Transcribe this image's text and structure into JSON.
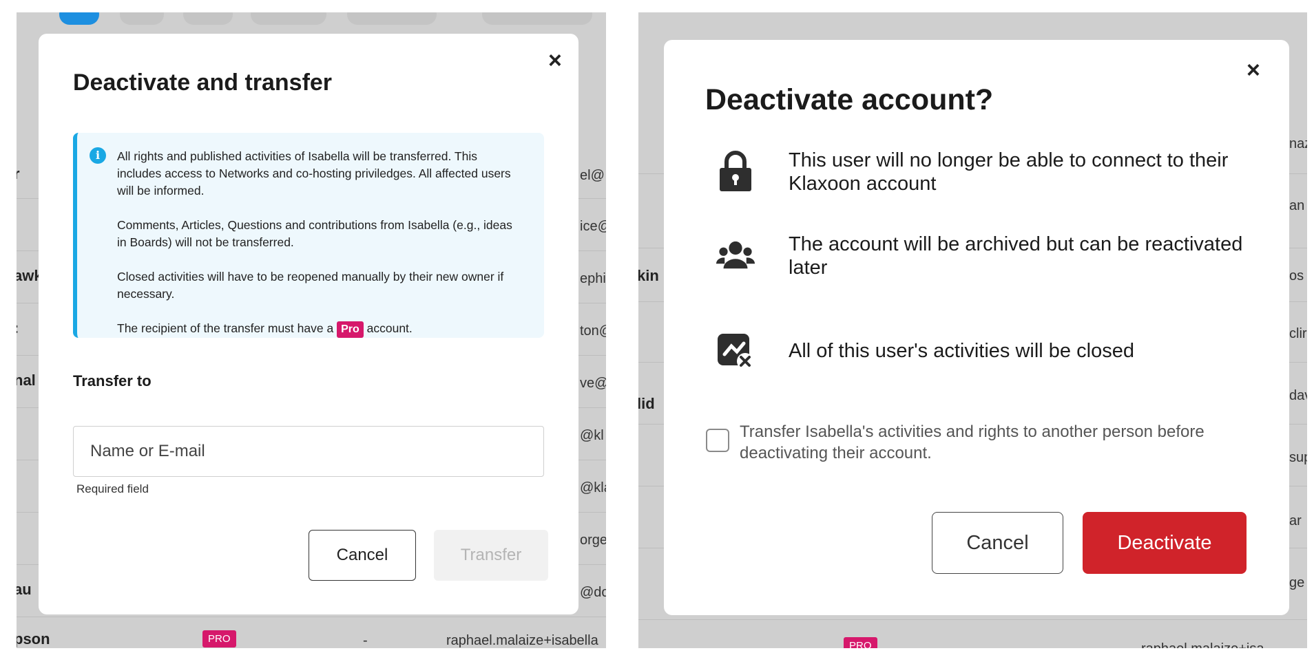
{
  "left": {
    "background": {
      "names": [
        "r",
        "awk",
        ":",
        "nal",
        "au",
        "pson"
      ],
      "emails": [
        "el@",
        "ice@",
        "ephi",
        "ton@",
        "ve@",
        "@kl",
        "@kla",
        "orge",
        "@do",
        "raphael.malaize+isabella"
      ],
      "pro_badge": "PRO",
      "dash": "-"
    },
    "modal": {
      "title": "Deactivate and transfer",
      "close_label": "×",
      "info_paragraphs": [
        "All rights and published activities of Isabella will be transferred. This includes access to Networks and co-hosting priviledges. All affected users will be informed.",
        "Comments, Articles, Questions and contributions from Isabella (e.g., ideas in Boards) will not be transferred.",
        "Closed activities will have to be reopened manually by their new owner if necessary."
      ],
      "info_last_before": "The recipient of the transfer must have a",
      "info_pro_tag": "Pro",
      "info_last_after": "account.",
      "transfer_label": "Transfer to",
      "input_placeholder": "Name or E-mail",
      "input_value": "",
      "helper_text": "Required field",
      "cancel_label": "Cancel",
      "transfer_button_label": "Transfer"
    }
  },
  "right": {
    "background": {
      "names": [
        "kin",
        "lid"
      ],
      "emails": [
        "naz",
        "an",
        "os",
        "clir",
        "dav",
        "sup",
        "ar",
        "ge"
      ],
      "pro_badge": "PRO",
      "email_partial": "raphael.malaize+isa"
    },
    "modal": {
      "title": "Deactivate account?",
      "close_label": "×",
      "features": [
        {
          "icon": "lock-icon",
          "text": "This user will no longer be able to connect to their Klaxoon account"
        },
        {
          "icon": "users-icon",
          "text": "The account will be archived but can be reactivated later"
        },
        {
          "icon": "activity-closed-icon",
          "text": "All of this user's activities will be closed"
        }
      ],
      "checkbox_label": "Transfer Isabella's activities and rights to another person before deactivating their account.",
      "checkbox_checked": false,
      "cancel_label": "Cancel",
      "deactivate_label": "Deactivate"
    }
  },
  "colors": {
    "info_accent": "#1aa8e4",
    "pro_pink": "#d6186b",
    "danger": "#d0232a"
  }
}
